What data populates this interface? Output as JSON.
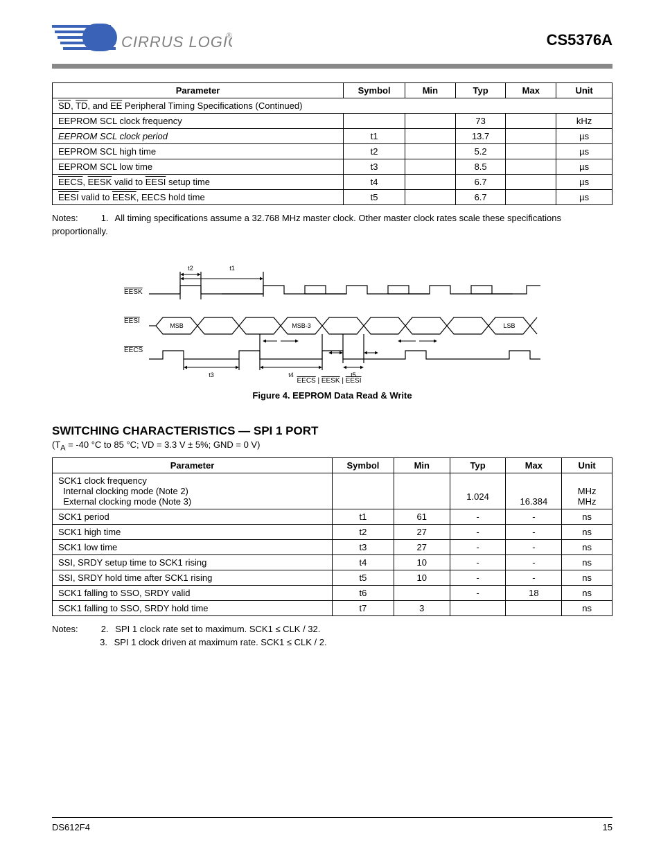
{
  "header": {
    "brand": "CIRRUS LOGIC",
    "product": "CS5376A"
  },
  "table1": {
    "headers": [
      "Parameter",
      "Symbol",
      "Min",
      "Typ",
      "Max",
      "Unit"
    ],
    "subhead": "SD, TD, and EE Peripheral Timing Specifications (Continued)",
    "rows": [
      {
        "p": "EEPROM SCL clock frequency",
        "sym": "",
        "min": "",
        "typ": "73",
        "max": "",
        "unit": "kHz",
        "i": false
      },
      {
        "p": "EEPROM SCL clock period",
        "sym": "t1",
        "min": "",
        "typ": "13.7",
        "max": "",
        "unit": "µs",
        "i": true
      },
      {
        "p": "EEPROM SCL high time",
        "sym": "t2",
        "min": "",
        "typ": "5.2",
        "max": "",
        "unit": "µs",
        "i": false
      },
      {
        "p": "EEPROM SCL low time",
        "sym": "t3",
        "min": "",
        "typ": "8.5",
        "max": "",
        "unit": "µs",
        "i": false
      },
      {
        "p": "EECS, EESK valid to EESI setup time",
        "sym": "t4",
        "min": "",
        "typ": "6.7",
        "max": "",
        "unit": "µs",
        "i": false,
        "over": [
          "EECS",
          "EESK"
        ]
      },
      {
        "p": "EESI valid to EESK, EECS hold time",
        "sym": "t5",
        "min": "",
        "typ": "6.7",
        "max": "",
        "unit": "µs",
        "i": false,
        "over": [
          "EESK"
        ]
      }
    ]
  },
  "note1": {
    "lead": "Notes:",
    "num": "1.",
    "text": "All timing specifications assume a 32.768 MHz master clock. Other master clock rates scale these specifications proportionally."
  },
  "figure": {
    "caption": "Figure 4. EEPROM Data Read & Write",
    "labels": {
      "sck": "EESK",
      "sio": "EESI",
      "cs": "EECS",
      "cs_sk_sio": "EECS | EESK | EESI"
    },
    "bits": [
      "MSB",
      "",
      "",
      "MSB-3",
      "",
      "",
      "",
      "",
      "",
      "LSB"
    ],
    "ts": {
      "t1": "t1",
      "t2": "t2",
      "t3": "t3",
      "t4": "t4",
      "t5": "t5"
    }
  },
  "section2": {
    "title": "SWITCHING CHARACTERISTICS — SPI 1 PORT",
    "cond_html": "(T<sub>A</sub> = -40 °C to 85 °C; VD = 3.3 V ± 5%; GND = 0 V)"
  },
  "table2": {
    "headers": [
      "Parameter",
      "Symbol",
      "Min",
      "Typ",
      "Max",
      "Unit"
    ],
    "rows": [
      {
        "p_lines": [
          "SCK1 clock frequency",
          "Internal clocking mode (Note 2)",
          "External clocking mode (Note 3)"
        ],
        "sym": "",
        "min": [
          "",
          "",
          ""
        ],
        "typ": [
          "",
          "1.024",
          ""
        ],
        "max": [
          "",
          "",
          "16.384"
        ],
        "unit": [
          "",
          "MHz",
          "MHz"
        ]
      },
      {
        "p": "SCK1 period",
        "sym": "t1",
        "min": "61",
        "typ": "-",
        "max": "-",
        "unit": "ns"
      },
      {
        "p": "SCK1 high time",
        "sym": "t2",
        "min": "27",
        "typ": "-",
        "max": "-",
        "unit": "ns"
      },
      {
        "p": "SCK1 low time",
        "sym": "t3",
        "min": "27",
        "typ": "-",
        "max": "-",
        "unit": "ns"
      },
      {
        "p": "SSI, SRDY setup time to SCK1 rising",
        "sym": "t4",
        "min": "10",
        "typ": "-",
        "max": "-",
        "unit": "ns"
      },
      {
        "p": "SSI, SRDY hold time after SCK1 rising",
        "sym": "t5",
        "min": "10",
        "typ": "-",
        "max": "-",
        "unit": "ns"
      },
      {
        "p": "SCK1 falling to SSO, SRDY valid",
        "sym": "t6",
        "min": "",
        "typ": "-",
        "max": "18",
        "unit": "ns"
      },
      {
        "p": "SCK1 falling to SSO, SRDY hold time",
        "sym": "t7",
        "min": "3",
        "typ": "",
        "max": "",
        "unit": "ns"
      }
    ]
  },
  "notes2": {
    "lead": "Notes:",
    "items": [
      {
        "num": "2.",
        "text": "SPI 1 clock rate set to maximum. SCK1 ≤ CLK / 32."
      },
      {
        "num": "3.",
        "text": "SPI 1 clock driven at maximum rate. SCK1 ≤ CLK / 2."
      }
    ]
  },
  "footer": {
    "left": "DS612F4",
    "right": "15"
  }
}
